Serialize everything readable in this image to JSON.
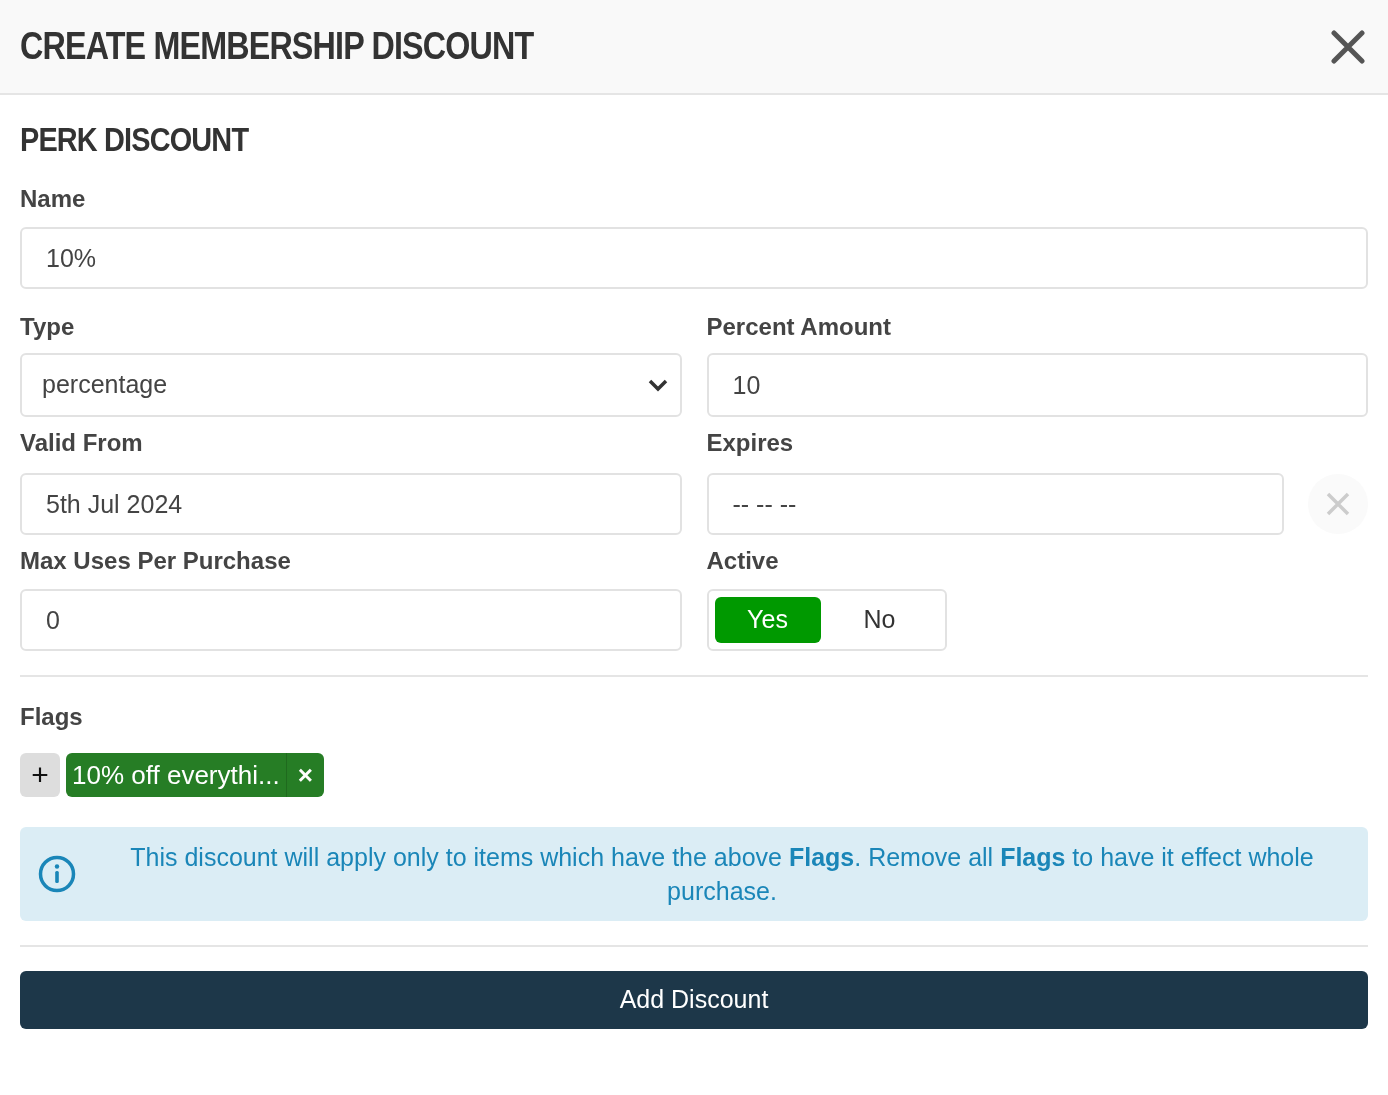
{
  "window": {
    "title": "CREATE MEMBERSHIP DISCOUNT"
  },
  "section": {
    "title": "PERK DISCOUNT"
  },
  "fields": {
    "name": {
      "label": "Name",
      "value": "10%"
    },
    "type": {
      "label": "Type",
      "value": "percentage"
    },
    "percent_amount": {
      "label": "Percent Amount",
      "value": "10"
    },
    "valid_from": {
      "label": "Valid From",
      "value": "5th Jul 2024"
    },
    "expires": {
      "label": "Expires",
      "value": "-- -- --"
    },
    "max_uses": {
      "label": "Max Uses Per Purchase",
      "value": "0"
    },
    "active": {
      "label": "Active",
      "options": [
        {
          "label": "Yes",
          "selected": true
        },
        {
          "label": "No",
          "selected": false
        }
      ]
    }
  },
  "flags": {
    "label": "Flags",
    "add": "+",
    "items": [
      {
        "label": "10% off everythi...",
        "remove": "×"
      }
    ]
  },
  "info": "This discount will apply only to items which have the above **Flags**. Remove all **Flags** to have it effect whole purchase.",
  "submit": "Add Discount"
}
